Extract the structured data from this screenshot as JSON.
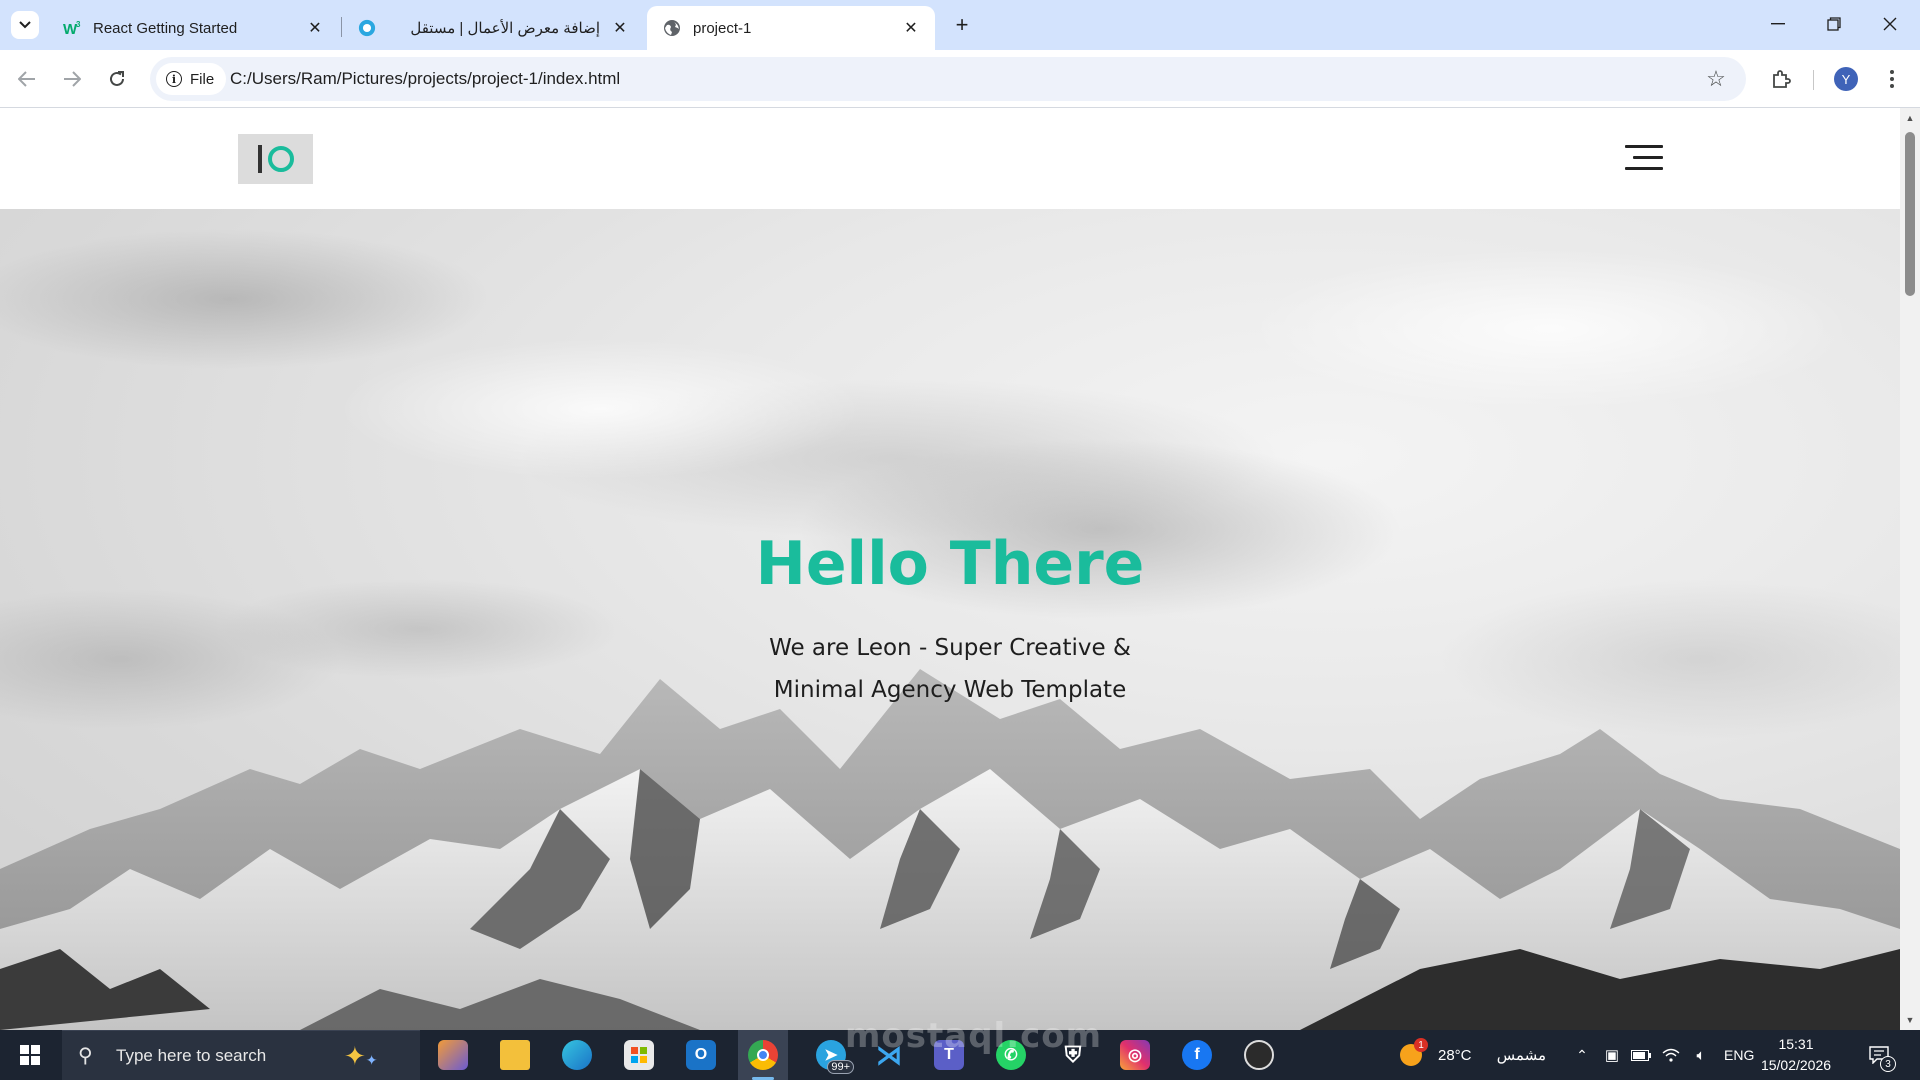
{
  "browser": {
    "tabs": [
      {
        "title": "React Getting Started",
        "favicon": "w3schools-icon",
        "active": false
      },
      {
        "title": "إضافة معرض الأعمال | مستقل",
        "favicon": "mostaql-icon",
        "active": false
      },
      {
        "title": "project-1",
        "favicon": "globe-icon",
        "active": true
      }
    ],
    "address": {
      "chip_label": "File",
      "url": "C:/Users/Ram/Pictures/projects/project-1/index.html"
    },
    "profile_initial": "Y"
  },
  "site": {
    "hero": {
      "title": "Hello There",
      "subtitle_line1": "We are Leon - Super Creative &",
      "subtitle_line2": "Minimal Agency Web Template"
    },
    "colors": {
      "accent": "#1abc9c",
      "header_bg": "#ffffff",
      "logo_bg": "#dcdcdc"
    }
  },
  "taskbar": {
    "search_placeholder": "Type here to search",
    "telegram_badge": "99+",
    "weather_temp": "28°C",
    "weather_text": "مشمس",
    "weather_alert": "1",
    "language": "ENG",
    "time": "15:31",
    "date": "15/02/2026",
    "notification_count": "3"
  },
  "watermark": "mostaql.com"
}
